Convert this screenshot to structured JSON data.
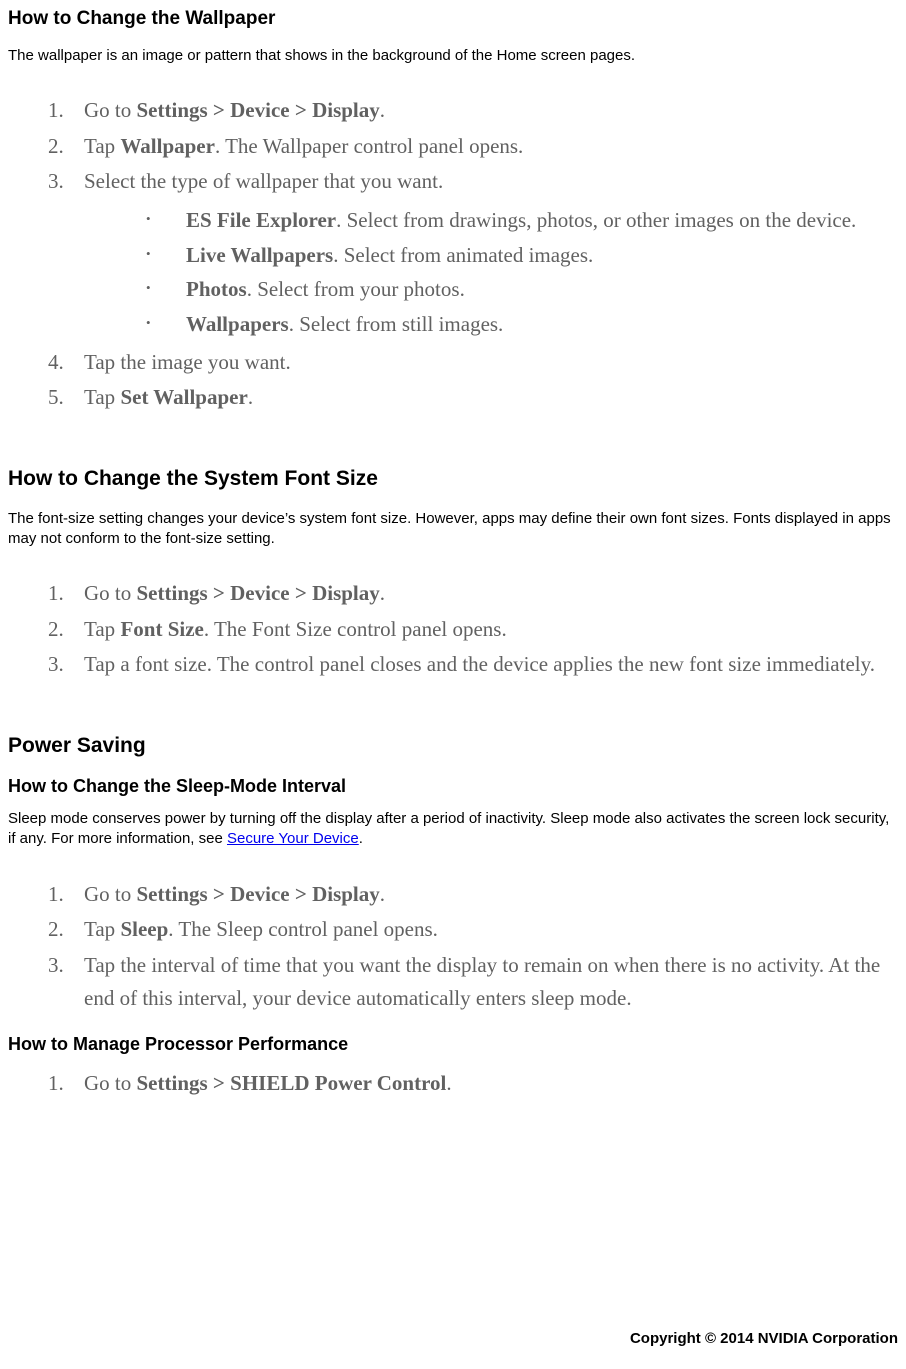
{
  "sectionA": {
    "title": "How to Change the Wallpaper",
    "intro": "The wallpaper is an image or pattern that shows in the background of the Home screen pages.",
    "step1_a": "Go to ",
    "step1_b": "Settings > Device > Display",
    "step1_c": ".",
    "step2_a": "Tap ",
    "step2_b": "Wallpaper",
    "step2_c": ". The Wallpaper control panel opens.",
    "step3": "Select the type of wallpaper that you want.",
    "sub1_b": "ES File Explorer",
    "sub1_t": ". Select from drawings, photos, or other images on the device.",
    "sub2_b": "Live Wallpapers",
    "sub2_t": ". Select from animated images.",
    "sub3_b": "Photos",
    "sub3_t": ". Select from your photos.",
    "sub4_b": "Wallpapers",
    "sub4_t": ". Select from still images.",
    "step4": "Tap the image you want.",
    "step5_a": "Tap ",
    "step5_b": "Set Wallpaper",
    "step5_c": "."
  },
  "sectionB": {
    "title": "How to Change the System Font Size",
    "intro": "The font-size setting changes your device’s system font size. However, apps may define their own font sizes. Fonts displayed in apps may not conform to the font-size setting.",
    "step1_a": "Go to ",
    "step1_b": "Settings > Device > Display",
    "step1_c": ".",
    "step2_a": "Tap ",
    "step2_b": "Font Size",
    "step2_c": ". The Font Size control panel opens.",
    "step3": "Tap a font size. The control panel closes and the device applies the new font size immediately."
  },
  "sectionC": {
    "title": "Power Saving",
    "subA": {
      "title": "How to Change the Sleep-Mode Interval",
      "intro_a": "Sleep mode conserves power by turning off the display after a period of inactivity. Sleep mode also activates the screen lock security, if any. For more information, see ",
      "intro_link": "Secure Your Device",
      "intro_b": ".",
      "step1_a": "Go to ",
      "step1_b": "Settings > Device > Display",
      "step1_c": ".",
      "step2_a": "Tap ",
      "step2_b": "Sleep",
      "step2_c": ". The Sleep control panel opens.",
      "step3": "Tap the interval of time that you want the display to remain on when there is no activity. At the end of this interval, your device automatically enters sleep mode."
    },
    "subB": {
      "title": "How to Manage Processor Performance",
      "step1_a": "Go to ",
      "step1_b": "Settings > SHIELD Power Control",
      "step1_c": "."
    }
  },
  "footer": "Copyright © 2014 NVIDIA Corporation"
}
